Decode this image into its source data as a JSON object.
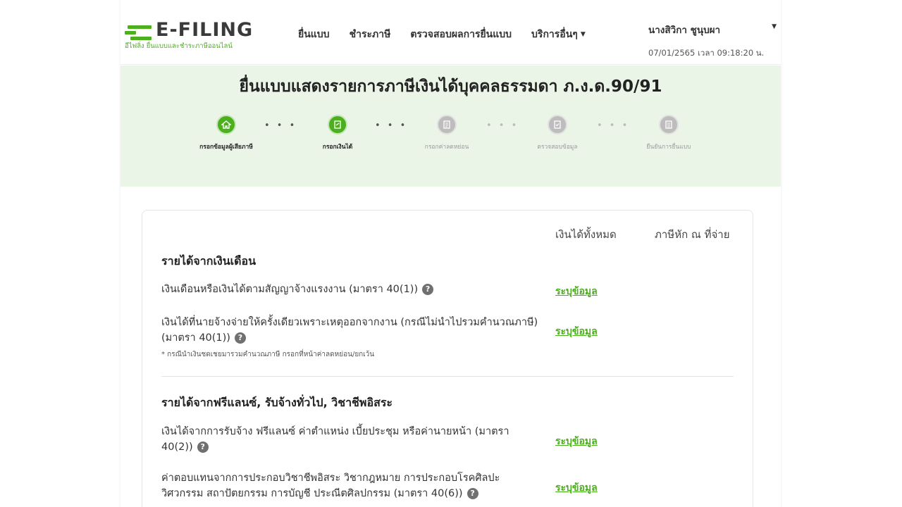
{
  "header": {
    "logo_text": "E-FILING",
    "logo_subtitle": "อีไฟลิ่ง ยื่นแบบและชำระภาษีออนไลน์",
    "nav": [
      {
        "label": "ยื่นแบบ"
      },
      {
        "label": "ชำระภาษี"
      },
      {
        "label": "ตรวจสอบผลการยื่นแบบ"
      },
      {
        "label": "บริการอื่นๆ"
      }
    ],
    "user_name": "นางสิวิกา ชูนุบผา",
    "datetime": "07/01/2565 เวลา 09:18:20 น."
  },
  "banner": {
    "title": "ยื่นแบบแสดงรายการภาษีเงินได้บุคคลธรรมดา ภ.ง.ด.90/91",
    "steps": [
      {
        "label": "กรอกข้อมูลผู้เสียภาษี",
        "state": "active",
        "icon": "home-icon"
      },
      {
        "label": "กรอกเงินได้",
        "state": "active",
        "icon": "document-edit-icon"
      },
      {
        "label": "กรอกค่าลดหย่อน",
        "state": "inactive",
        "icon": "document-icon"
      },
      {
        "label": "ตรวจสอบข้อมูล",
        "state": "inactive",
        "icon": "document-check-icon"
      },
      {
        "label": "ยืนยันการยื่นแบบ",
        "state": "inactive",
        "icon": "document-confirm-icon"
      }
    ]
  },
  "income": {
    "col_total": "เงินได้ทั้งหมด",
    "col_withheld": "ภาษีหัก ณ ที่จ่าย",
    "sections": [
      {
        "title": "รายได้จากเงินเดือน",
        "rows": [
          {
            "text": "เงินเดือนหรือเงินได้ตามสัญญาจ้างแรงงาน (มาตรา 40(1))",
            "link": "ระบุข้อมูล"
          },
          {
            "text_line1": "เงินได้ที่นายจ้างจ่ายให้ครั้งเดียวเพราะเหตุออกจากงาน (กรณีไม่นำไปรวมคำนวณภาษี)",
            "text_line2": "(มาตรา 40(1))",
            "note": "* กรณีนำเงินชดเชยมารวมคำนวณภาษี กรอกที่หน้าค่าลดหย่อน/ยกเว้น",
            "link": "ระบุข้อมูล"
          }
        ]
      },
      {
        "title": "รายได้จากฟรีแลนซ์, รับจ้างทั่วไป, วิชาชีพอิสระ",
        "rows": [
          {
            "text_line1": "เงินได้จากการรับจ้าง ฟรีแลนซ์ ค่าตำแหน่ง เบี้ยประชุม หรือค่านายหน้า (มาตรา",
            "text_line2": "40(2))",
            "link": "ระบุข้อมูล"
          },
          {
            "text_line1": "ค่าตอบแทนจากการประกอบวิชาชีพอิสระ วิชากฎหมาย การประกอบโรคศิลปะ",
            "text_line2": "วิศวกรรม สถาปัตยกรรม การบัญชี ประณีตศิลปกรรม (มาตรา 40(6))",
            "link": "ระบุข้อมูล"
          }
        ]
      }
    ]
  },
  "colors": {
    "brand_green": "#4caf1e",
    "banner_bg": "#eaf5e8",
    "inactive_step": "#bdbdbd"
  }
}
